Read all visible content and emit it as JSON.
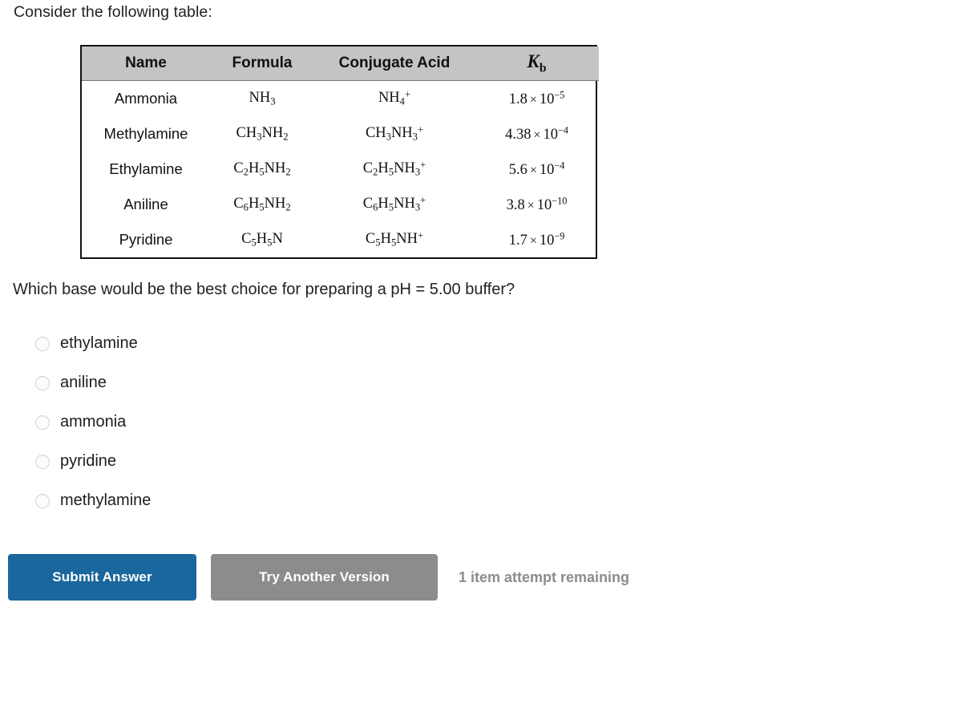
{
  "intro": "Consider the following table:",
  "table": {
    "headers": {
      "name": "Name",
      "formula": "Formula",
      "conjugate": "Conjugate Acid",
      "kb_symbol": "K",
      "kb_subscript": "b"
    },
    "rows": [
      {
        "name": "Ammonia",
        "formula": "NH3",
        "formula_html": "NH<sub>3</sub>",
        "conjugate": "NH4+",
        "conjugate_html": "NH<sub>4</sub><sup>+</sup>",
        "kb_mantissa": "1.8",
        "kb_exponent": "−5",
        "kb_text": "1.8 × 10⁻⁵"
      },
      {
        "name": "Methylamine",
        "formula": "CH3NH2",
        "formula_html": "CH<sub>3</sub>NH<sub>2</sub>",
        "conjugate": "CH3NH3+",
        "conjugate_html": "CH<sub>3</sub>NH<sub>3</sub><sup>+</sup>",
        "kb_mantissa": "4.38",
        "kb_exponent": "−4",
        "kb_text": "4.38 × 10⁻⁴"
      },
      {
        "name": "Ethylamine",
        "formula": "C2H5NH2",
        "formula_html": "C<sub>2</sub>H<sub>5</sub>NH<sub>2</sub>",
        "conjugate": "C2H5NH3+",
        "conjugate_html": "C<sub>2</sub>H<sub>5</sub>NH<sub>3</sub><sup>+</sup>",
        "kb_mantissa": "5.6",
        "kb_exponent": "−4",
        "kb_text": "5.6 × 10⁻⁴"
      },
      {
        "name": "Aniline",
        "formula": "C6H5NH2",
        "formula_html": "C<sub>6</sub>H<sub>5</sub>NH<sub>2</sub>",
        "conjugate": "C6H5NH3+",
        "conjugate_html": "C<sub>6</sub>H<sub>5</sub>NH<sub>3</sub><sup>+</sup>",
        "kb_mantissa": "3.8",
        "kb_exponent": "−10",
        "kb_text": "3.8 × 10⁻¹⁰"
      },
      {
        "name": "Pyridine",
        "formula": "C5H5N",
        "formula_html": "C<sub>5</sub>H<sub>5</sub>N",
        "conjugate": "C5H5NH+",
        "conjugate_html": "C<sub>5</sub>H<sub>5</sub>NH<sup>+</sup>",
        "kb_mantissa": "1.7",
        "kb_exponent": "−9",
        "kb_text": "1.7 × 10⁻⁹"
      }
    ]
  },
  "question": "Which base would be the best choice for preparing a pH = 5.00 buffer?",
  "options": [
    {
      "label": "ethylamine",
      "selected": false
    },
    {
      "label": "aniline",
      "selected": false
    },
    {
      "label": "ammonia",
      "selected": false
    },
    {
      "label": "pyridine",
      "selected": false
    },
    {
      "label": "methylamine",
      "selected": false
    }
  ],
  "footer": {
    "submit_label": "Submit Answer",
    "try_another_label": "Try Another Version",
    "attempts_text": "1 item attempt remaining",
    "submit_color": "#19679c",
    "try_another_color": "#8c8c8c",
    "attempts_color": "#8c8c8c"
  }
}
